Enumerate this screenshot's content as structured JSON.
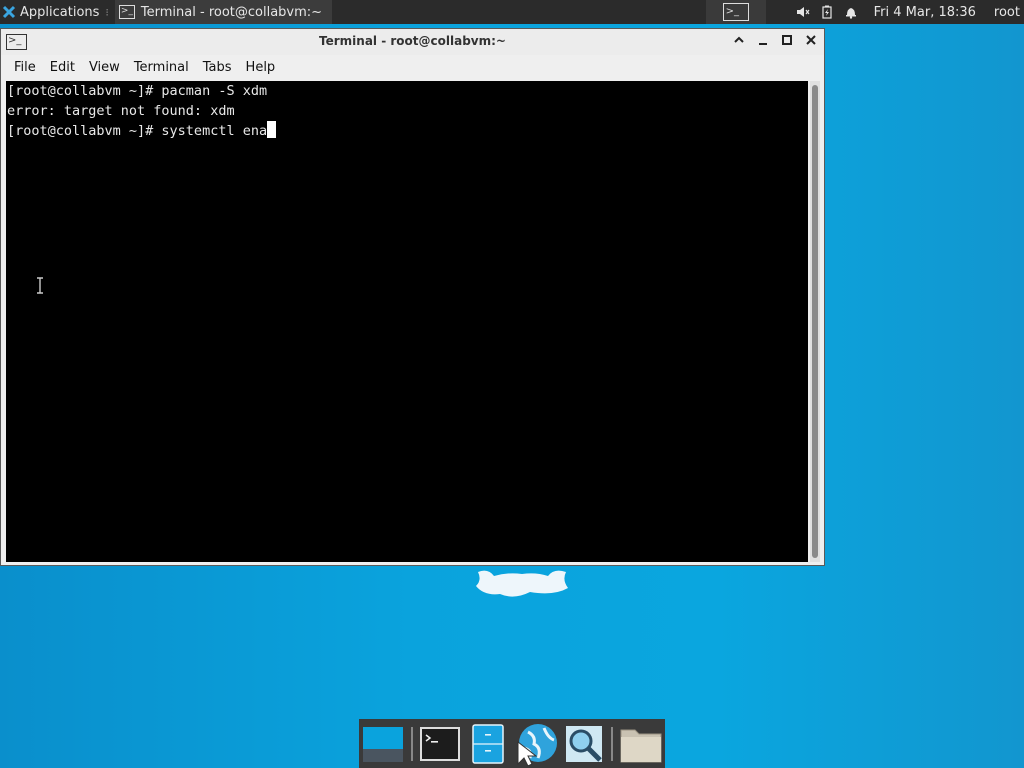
{
  "top_panel": {
    "applications_label": "Applications",
    "separator_glyph": "⁝",
    "task_title": "Terminal - root@collabvm:~",
    "clock": "Fri  4 Mar, 18:36",
    "user": "root",
    "icons": [
      "xfce-logo-icon",
      "terminal-icon",
      "volume-icon",
      "battery-icon",
      "notification-bell-icon"
    ]
  },
  "window": {
    "title": "Terminal - root@collabvm:~",
    "buttons": [
      "maximize-up",
      "minimize",
      "maximize",
      "close"
    ],
    "menu": [
      "File",
      "Edit",
      "View",
      "Terminal",
      "Tabs",
      "Help"
    ]
  },
  "terminal": {
    "lines": [
      "[root@collabvm ~]# pacman -S xdm",
      "error: target not found: xdm",
      "[root@collabvm ~]# systemctl ena"
    ]
  },
  "dock": {
    "items": [
      "show-desktop-icon",
      "terminal-icon",
      "file-manager-icon",
      "web-browser-icon",
      "app-finder-icon",
      "folder-icon"
    ]
  },
  "colors": {
    "desktop": "#0aa3dd",
    "panel": "#2b2b2b",
    "terminal_bg": "#000000",
    "terminal_fg": "#e8e8e8"
  }
}
